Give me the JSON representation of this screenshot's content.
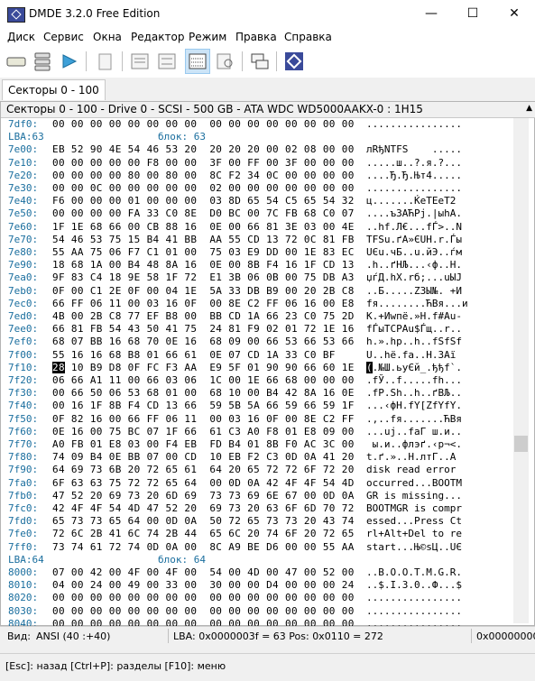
{
  "window": {
    "title": "DMDE 3.2.0 Free Edition",
    "minimize": "—",
    "maximize": "☐",
    "close": "✕"
  },
  "menu": [
    "Диск",
    "Сервис",
    "Окна",
    "Редактор",
    "Режим",
    "Правка",
    "Справка"
  ],
  "toolbar": [
    "drive-icon",
    "partitions-icon",
    "play-icon",
    "file-icon",
    "panel-icon",
    "panel2-icon",
    "hex-view-icon",
    "find-icon",
    "copy-icon",
    "dmde-icon"
  ],
  "tab": "Секторы 0 - 100",
  "header": "Секторы 0 - 100 - Drive 0 - SCSI - 500 GB - ATA WDC WD5000AAKX-0 : 1H15",
  "rows": [
    {
      "addr": "7df0:",
      "hex": "00 00 00 00 00 00 00 00  00 00 00 00 00 00 00 00",
      "asc": "................"
    },
    {
      "label": "LBA:63",
      "name": "блок: 63"
    },
    {
      "addr": "7e00:",
      "hex": "EB 52 90 4E 54 46 53 20  20 20 20 00 02 08 00 00",
      "asc": "лRђNTFS    ....."
    },
    {
      "addr": "7e10:",
      "hex": "00 00 00 00 00 F8 00 00  3F 00 FF 00 3F 00 00 00",
      "asc": ".....ш..?.я.?..."
    },
    {
      "addr": "7e20:",
      "hex": "00 00 00 00 80 00 80 00  8C F2 34 0C 00 00 00 00",
      "asc": "....Ђ.Ђ.Њт4....."
    },
    {
      "addr": "7e30:",
      "hex": "00 00 0C 00 00 00 00 00  02 00 00 00 00 00 00 00",
      "asc": "................"
    },
    {
      "addr": "7e40:",
      "hex": "F6 00 00 00 01 00 00 00  03 8D 65 54 C5 65 54 32",
      "asc": "ц.......ЌeTЕeT2"
    },
    {
      "addr": "7e50:",
      "hex": "00 00 00 00 FA 33 C0 8E  D0 BC 00 7C FB 68 C0 07",
      "asc": "....ъ3АЋРј.|ыhА."
    },
    {
      "addr": "7e60:",
      "hex": "1F 1E 68 66 00 CB 88 16  0E 00 66 81 3E 03 00 4E",
      "asc": "..hf.Л€...fЃ>..N"
    },
    {
      "addr": "7e70:",
      "hex": "54 46 53 75 15 B4 41 BB  AA 55 CD 13 72 0C 81 FB",
      "asc": "TFSu.ґA»ЄUН.r.Ѓы"
    },
    {
      "addr": "7e80:",
      "hex": "55 AA 75 06 F7 C1 01 00  75 03 E9 DD 00 1E 83 EC",
      "asc": "UЄu.чБ..u.йЭ..ѓм"
    },
    {
      "addr": "7e90:",
      "hex": "18 68 1A 00 B4 48 8A 16  0E 00 8B F4 16 1F CD 13",
      "asc": ".h..ґHЉ...‹ф..Н."
    },
    {
      "addr": "7ea0:",
      "hex": "9F 83 C4 18 9E 58 1F 72  E1 3B 06 0B 00 75 DB A3",
      "asc": "џѓД.hX.rб;...uЫЈ"
    },
    {
      "addr": "7eb0:",
      "hex": "0F 00 C1 2E 0F 00 04 1E  5A 33 DB B9 00 20 2B C8",
      "asc": "..Б.....Z3Ы№. +И"
    },
    {
      "addr": "7ec0:",
      "hex": "66 FF 06 11 00 03 16 0F  00 8E C2 FF 06 16 00 E8",
      "asc": "fя........ЋВя...и"
    },
    {
      "addr": "7ed0:",
      "hex": "4B 00 2B C8 77 EF B8 00  BB CD 1A 66 23 C0 75 2D",
      "asc": "K.+Иwпё.»Н.f#Аu-"
    },
    {
      "addr": "7ee0:",
      "hex": "66 81 FB 54 43 50 41 75  24 81 F9 02 01 72 1E 16",
      "asc": "fЃыTCPAu$Ѓщ..r.."
    },
    {
      "addr": "7ef0:",
      "hex": "68 07 BB 16 68 70 0E 16  68 09 00 66 53 66 53 66",
      "asc": "h.».hp..h..fSfSf"
    },
    {
      "addr": "7f00:",
      "hex": "55 16 16 68 B8 01 66 61  0E 07 CD 1A 33 C0 BF",
      "asc": "U..hё.fa..Н.3Аї"
    },
    {
      "addr": "7f10:",
      "hex": "28 10 B9 D8 0F FC F3 AA  E9 5F 01 90 90 66 60 1E",
      "asc": "(.№Ш.ьуЄй_.ђђf`.",
      "cursor": true
    },
    {
      "addr": "7f20:",
      "hex": "06 66 A1 11 00 66 03 06  1C 00 1E 66 68 00 00 00",
      "asc": ".fЎ..f.....fh..."
    },
    {
      "addr": "7f30:",
      "hex": "00 66 50 06 53 68 01 00  68 10 00 B4 42 8A 16 0E",
      "asc": ".fP.Sh..h..ґBЉ.."
    },
    {
      "addr": "7f40:",
      "hex": "00 16 1F 8B F4 CD 13 66  59 5B 5A 66 59 66 59 1F",
      "asc": "...‹фН.fY[ZfYfY."
    },
    {
      "addr": "7f50:",
      "hex": "0F 82 16 00 66 FF 06 11  00 03 16 0F 00 8E C2 FF",
      "asc": ".‚..fя.......ЋВя"
    },
    {
      "addr": "7f60:",
      "hex": "0E 16 00 75 BC 07 1F 66  61 C3 A0 F8 01 E8 09 00",
      "asc": "...uј..faГ ш.и.."
    },
    {
      "addr": "7f70:",
      "hex": "A0 FB 01 E8 03 00 F4 EB  FD B4 01 8B F0 AC 3C 00",
      "asc": " ы.и..флэґ.‹р¬<."
    },
    {
      "addr": "7f80:",
      "hex": "74 09 B4 0E BB 07 00 CD  10 EB F2 C3 0D 0A 41 20",
      "asc": "t.ґ.»..Н.лтГ..A "
    },
    {
      "addr": "7f90:",
      "hex": "64 69 73 6B 20 72 65 61  64 20 65 72 72 6F 72 20",
      "asc": "disk read error "
    },
    {
      "addr": "7fa0:",
      "hex": "6F 63 63 75 72 72 65 64  00 0D 0A 42 4F 4F 54 4D",
      "asc": "occurred...BOOTM"
    },
    {
      "addr": "7fb0:",
      "hex": "47 52 20 69 73 20 6D 69  73 73 69 6E 67 00 0D 0A",
      "asc": "GR is missing..."
    },
    {
      "addr": "7fc0:",
      "hex": "42 4F 4F 54 4D 47 52 20  69 73 20 63 6F 6D 70 72",
      "asc": "BOOTMGR is compr"
    },
    {
      "addr": "7fd0:",
      "hex": "65 73 73 65 64 00 0D 0A  50 72 65 73 73 20 43 74",
      "asc": "essed...Press Ct"
    },
    {
      "addr": "7fe0:",
      "hex": "72 6C 2B 41 6C 74 2B 44  65 6C 20 74 6F 20 72 65",
      "asc": "rl+Alt+Del to re"
    },
    {
      "addr": "7ff0:",
      "hex": "73 74 61 72 74 0D 0A 00  8C A9 BE D6 00 00 55 AA",
      "asc": "start...Њ©ѕЦ..UЄ"
    },
    {
      "label": "LBA:64",
      "name": "блок: 64"
    },
    {
      "addr": "8000:",
      "hex": "07 00 42 00 4F 00 4F 00  54 00 4D 00 47 00 52 00",
      "asc": "..B.O.O.T.M.G.R."
    },
    {
      "addr": "8010:",
      "hex": "04 00 24 00 49 00 33 00  30 00 00 D4 00 00 00 24",
      "asc": "..$.I.3.0..Ф...$"
    },
    {
      "addr": "8020:",
      "hex": "00 00 00 00 00 00 00 00  00 00 00 00 00 00 00 00",
      "asc": "................"
    },
    {
      "addr": "8030:",
      "hex": "00 00 00 00 00 00 00 00  00 00 00 00 00 00 00 00",
      "asc": "................"
    },
    {
      "addr": "8040:",
      "hex": "00 00 00 00 00 00 00 00  00 00 00 00 00 00 00 00",
      "asc": "................"
    }
  ],
  "status": {
    "view": "Вид:",
    "mode": "ANSI (40 :+40)",
    "lba": "LBA: 0x0000003f = 63  Pos: 0x0110 = 272",
    "offset": "0x00000000"
  },
  "hint": "[Esc]: назад  [Ctrl+P]: разделы  [F10]: меню"
}
